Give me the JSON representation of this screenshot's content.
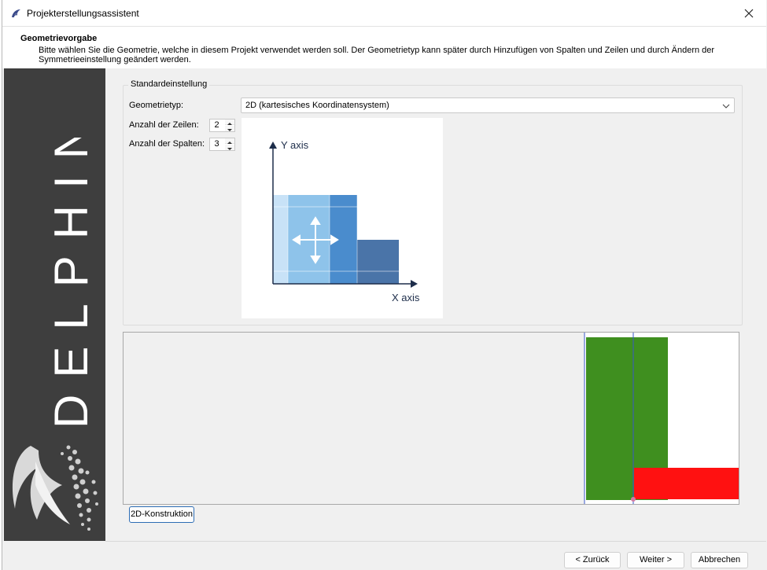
{
  "window": {
    "title": "Projekterstellungsassistent",
    "close_icon": "close-icon",
    "app_icon": "dolphin-icon"
  },
  "header": {
    "title": "Geometrievorgabe",
    "description": "Bitte wählen Sie die Geometrie, welche in diesem Projekt verwendet werden soll. Der Geometrietyp kann später durch Hinzufügen von Spalten und Zeilen und durch Ändern der Symmetrieeinstellung geändert werden."
  },
  "banner": {
    "brand": "DELPHIN"
  },
  "settings": {
    "group_title": "Standardeinstellung",
    "geometry_type_label": "Geometrietyp:",
    "geometry_type_value": "2D (kartesisches Koordinatensystem)",
    "rows_label": "Anzahl der Zeilen:",
    "rows_value": "2",
    "cols_label": "Anzahl der Spalten:",
    "cols_value": "3"
  },
  "preview": {
    "y_axis": "Y axis",
    "x_axis": "X axis"
  },
  "view3d": {
    "colors": {
      "green": "#3f8f1f",
      "red": "#ff1111",
      "line": "#3a57c9"
    }
  },
  "construction_button": "2D-Konstruktion",
  "footer": {
    "back": "< Zurück",
    "next": "Weiter >",
    "cancel": "Abbrechen"
  }
}
